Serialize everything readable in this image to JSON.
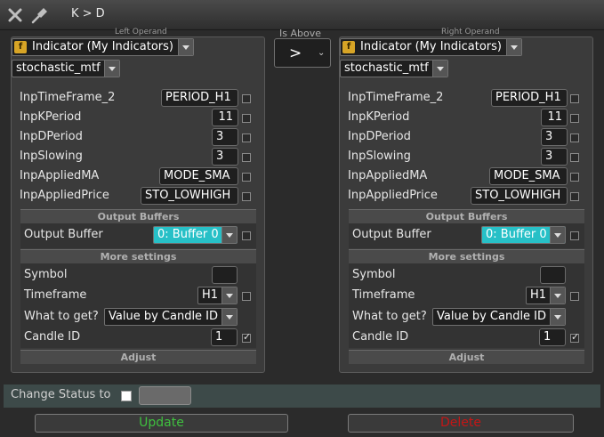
{
  "window": {
    "title": "K > D",
    "close_icon": "close-icon",
    "pin_icon": "pin-icon"
  },
  "operator": {
    "caption": "Is Above",
    "symbol": ">"
  },
  "left": {
    "caption": "Left Operand",
    "source": "Indicator (My Indicators)",
    "indicator": "stochastic_mtf",
    "params": [
      {
        "label": "InpTimeFrame_2",
        "value": "PERIOD_H1"
      },
      {
        "label": "InpKPeriod",
        "value": "11"
      },
      {
        "label": "InpDPeriod",
        "value": "3"
      },
      {
        "label": "InpSlowing",
        "value": "3"
      },
      {
        "label": "InpAppliedMA",
        "value": "MODE_SMA"
      },
      {
        "label": "InpAppliedPrice",
        "value": "STO_LOWHIGH"
      }
    ],
    "output_buffers_title": "Output Buffers",
    "output_buffer_label": "Output Buffer",
    "output_buffer_value": "0: Buffer 0",
    "more_settings_title": "More settings",
    "symbol_label": "Symbol",
    "symbol_value": "",
    "timeframe_label": "Timeframe",
    "timeframe_value": "H1",
    "what_label": "What to get?",
    "what_value": "Value by Candle ID",
    "candle_label": "Candle ID",
    "candle_value": "1",
    "adjust": "Adjust"
  },
  "right": {
    "caption": "Right Operand",
    "source": "Indicator (My Indicators)",
    "indicator": "stochastic_mtf",
    "params": [
      {
        "label": "InpTimeFrame_2",
        "value": "PERIOD_H1"
      },
      {
        "label": "InpKPeriod",
        "value": "11"
      },
      {
        "label": "InpDPeriod",
        "value": "3"
      },
      {
        "label": "InpSlowing",
        "value": "3"
      },
      {
        "label": "InpAppliedMA",
        "value": "MODE_SMA"
      },
      {
        "label": "InpAppliedPrice",
        "value": "STO_LOWHIGH"
      }
    ],
    "output_buffers_title": "Output Buffers",
    "output_buffer_label": "Output Buffer",
    "output_buffer_value": "0: Buffer 0",
    "more_settings_title": "More settings",
    "symbol_label": "Symbol",
    "symbol_value": "",
    "timeframe_label": "Timeframe",
    "timeframe_value": "H1",
    "what_label": "What to get?",
    "what_value": "Value by Candle ID",
    "candle_label": "Candle ID",
    "candle_value": "1",
    "adjust": "Adjust"
  },
  "status": {
    "label": "Change Status to",
    "value": ""
  },
  "buttons": {
    "update": "Update",
    "delete": "Delete"
  },
  "colors": {
    "update": "#3fc03f",
    "delete": "#c41616",
    "accent": "#27c0c7",
    "icon": "#d8a526"
  }
}
